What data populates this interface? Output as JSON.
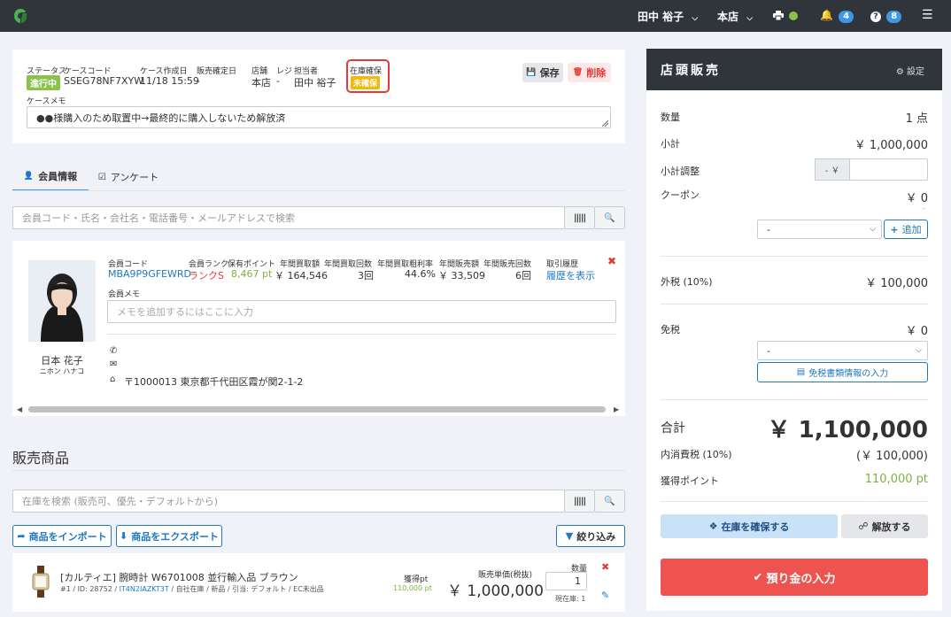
{
  "topbar": {
    "user": "田中 裕子",
    "store": "本店",
    "notifications": "4",
    "help_count": "8"
  },
  "case": {
    "status_label": "ステータス",
    "status_value": "進行中",
    "code_label": "ケースコード",
    "code_value": "SSEG78NF7XYW",
    "created_label": "ケース作成日",
    "created_value": "11/18 15:59",
    "sale_date_label": "販売確定日",
    "sale_date_value": "-",
    "store_label": "店舗",
    "store_value": "本店",
    "register_label": "レジ",
    "register_value": "-",
    "staff_label": "担当者",
    "staff_value": "田中 裕子",
    "stock_label": "在庫確保",
    "stock_value": "未確保",
    "save_label": "保存",
    "delete_label": "削除",
    "memo_label": "ケースメモ",
    "memo_value": "●●様購入のため取置中→最終的に購入しないため解放済"
  },
  "tabs": {
    "member_info": "会員情報",
    "survey": "アンケート"
  },
  "member_search": {
    "placeholder": "会員コード・氏名・会社名・電話番号・メールアドレスで検索"
  },
  "member": {
    "code_label": "会員コード",
    "code_value": "MBA9P9GFEWRD",
    "rank_label": "会員ランク",
    "rank_value": "ランクS",
    "points_label": "保有ポイント",
    "points_value": "8,467 pt",
    "annual_purchase_amount_label": "年間買取額",
    "annual_purchase_amount_value": "￥ 164,546",
    "annual_purchase_count_label": "年間買取回数",
    "annual_purchase_count_value": "3回",
    "annual_margin_label": "年間買取粗利率",
    "annual_margin_value": "44.6%",
    "annual_sales_amount_label": "年間販売額",
    "annual_sales_amount_value": "￥ 33,509",
    "annual_sales_count_label": "年間販売回数",
    "annual_sales_count_value": "6回",
    "history_label": "取引履歴",
    "history_link": "履歴を表示",
    "memo_label": "会員メモ",
    "memo_placeholder": "メモを追加するにはここに入力",
    "name": "日本 花子",
    "name_kana": "ニホン ハナコ",
    "address": "〒1000013 東京都千代田区霞が関2-1-2"
  },
  "products": {
    "section_title": "販売商品",
    "search_placeholder": "在庫を検索 (販売可、優先・デフォルトから)",
    "import_label": "商品をインポート",
    "export_label": "商品をエクスポート",
    "filter_label": "絞り込み",
    "items": [
      {
        "title": "[カルティエ] 腕時計 W6701008 並行輸入品 ブラウン",
        "meta_prefix": "#1 / ID: 28752 / ",
        "meta_link": "IT4N2IAZKT3T",
        "meta_suffix": " / 自社在庫 / 新品 / 引当: デフォルト / EC未出品",
        "points_label": "獲得pt",
        "points_value": "110,000 pt",
        "price_label": "販売単価(税抜)",
        "price_value": "￥ 1,000,000",
        "qty_label": "数量",
        "qty_value": "1",
        "stock_label": "現在庫: 1"
      }
    ]
  },
  "pos": {
    "title": "店頭販売",
    "settings_label": "設定",
    "quantity_label": "数量",
    "quantity_value": "1 点",
    "subtotal_label": "小計",
    "subtotal_value": "￥ 1,000,000",
    "adjust_label": "小計調整",
    "adjust_prefix": "- ￥",
    "coupon_label": "クーポン",
    "coupon_value": "￥ 0",
    "coupon_dash": "-",
    "coupon_select": "-",
    "add_label": "追加",
    "outer_tax_label": "外税 (10%)",
    "outer_tax_value": "￥ 100,000",
    "tax_free_label": "免税",
    "tax_free_value": "￥ 0",
    "tax_free_select": "-",
    "tax_free_button": "免税書類情報の入力",
    "total_label": "合計",
    "total_value": "￥ 1,100,000",
    "inner_tax_label": "内消費税 (10%)",
    "inner_tax_value": "(￥ 100,000)",
    "earned_points_label": "獲得ポイント",
    "earned_points_value": "110,000 pt",
    "reserve_label": "在庫を確保する",
    "release_label": "解放する",
    "deposit_label": "預り金の入力"
  },
  "colors": {
    "topbar": "#2f353b",
    "status_green": "#8bc34a",
    "stock_yellow": "#f0b90b",
    "link_blue": "#1f78c1",
    "points_green": "#7cb342",
    "primary_red": "#ef5350",
    "highlight_red": "#e53935"
  }
}
